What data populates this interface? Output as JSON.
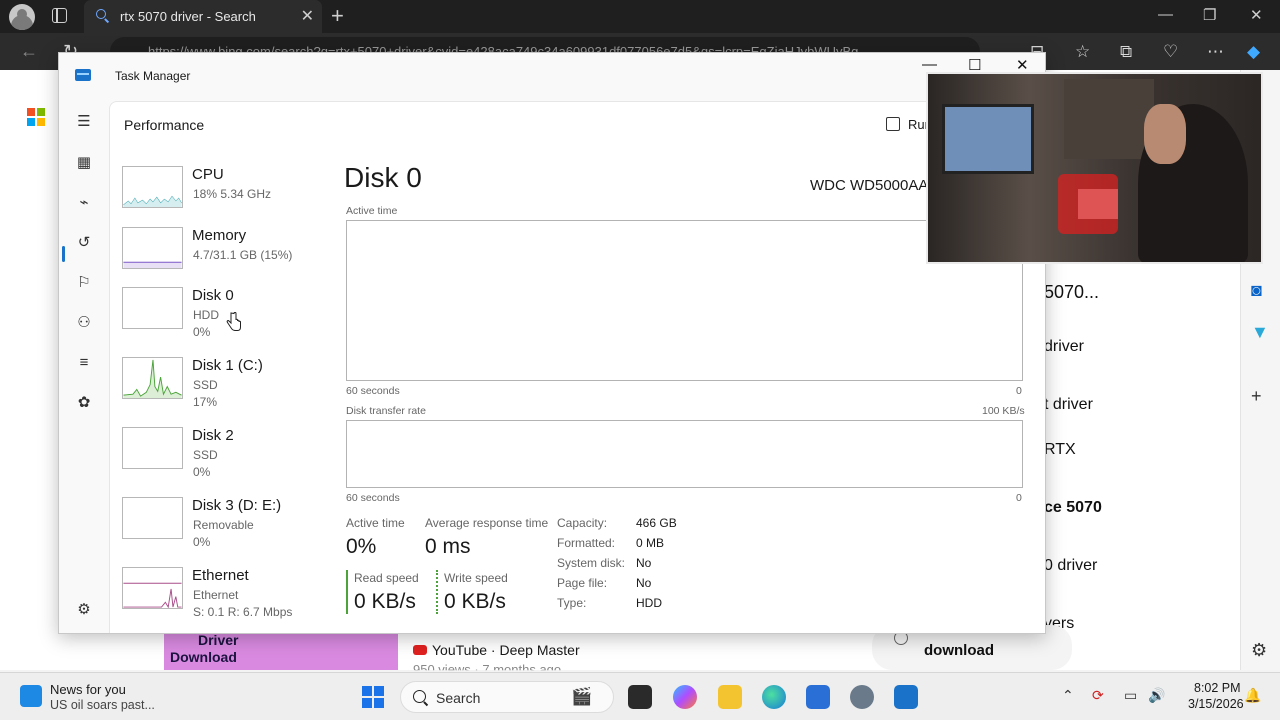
{
  "browser": {
    "tab_title": "rtx 5070 driver - Search",
    "url": "https://www.bing.com/search?q=rtx+5070+driver&cvid=e428aca749c34a609931df077056e7d5&qs=lcrp=EgZjaHJvbWUyBg",
    "new_tab": "+",
    "tab_close": "✕",
    "minimize": "—",
    "restore": "❐",
    "close": "✕"
  },
  "bing": {
    "right_snippets": [
      "5070...",
      "driver",
      "t driver",
      "RTX",
      "ce 5070",
      "0 driver",
      "vers"
    ],
    "card_text_line1": "Driver",
    "card_text_line2": "Download",
    "youtube_line": "YouTube · Deep Master",
    "youtube_sub": "950 views · 7 months ago",
    "download_text": "download"
  },
  "task_manager": {
    "title": "Task Manager",
    "section": "Performance",
    "run_task_label": "Run",
    "items": [
      {
        "name": "CPU",
        "sub1": "18%  5.34 GHz",
        "sub2": ""
      },
      {
        "name": "Memory",
        "sub1": "4.7/31.1 GB (15%)",
        "sub2": ""
      },
      {
        "name": "Disk 0",
        "sub1": "HDD",
        "sub2": "0%"
      },
      {
        "name": "Disk 1 (C:)",
        "sub1": "SSD",
        "sub2": "17%"
      },
      {
        "name": "Disk 2",
        "sub1": "SSD",
        "sub2": "0%"
      },
      {
        "name": "Disk 3 (D: E:)",
        "sub1": "Removable",
        "sub2": "0%"
      },
      {
        "name": "Ethernet",
        "sub1": "Ethernet",
        "sub2": "S: 0.1  R: 6.7 Mbps"
      }
    ],
    "detail": {
      "title": "Disk 0",
      "model": "WDC WD5000AA",
      "active_time_label": "Active time",
      "graph1_left": "60 seconds",
      "graph1_right": "0",
      "transfer_label": "Disk transfer rate",
      "transfer_max": "100 KB/s",
      "graph2_left": "60 seconds",
      "graph2_right": "0",
      "stats": {
        "active_time_label": "Active time",
        "active_time_value": "0%",
        "avg_response_label": "Average response time",
        "avg_response_value": "0 ms",
        "read_label": "Read speed",
        "read_value": "0 KB/s",
        "write_label": "Write speed",
        "write_value": "0 KB/s"
      },
      "properties": [
        {
          "label": "Capacity:",
          "value": "466 GB"
        },
        {
          "label": "Formatted:",
          "value": "0 MB"
        },
        {
          "label": "System disk:",
          "value": "No"
        },
        {
          "label": "Page file:",
          "value": "No"
        },
        {
          "label": "Type:",
          "value": "HDD"
        }
      ]
    }
  },
  "taskbar": {
    "news_title": "News for you",
    "news_sub": "US oil soars past...",
    "search_placeholder": "Search",
    "time": "8:02 PM",
    "date": "3/15/2026"
  },
  "colors": {
    "accent": "#1a73c9",
    "cpu_graph": "#3aa6b0",
    "memory_graph": "#7a58c7",
    "disk1_graph": "#4ba33a",
    "ethernet_graph": "#a84d8a",
    "read_bar": "#4ba33a",
    "write_bar": "#4ba33a"
  }
}
